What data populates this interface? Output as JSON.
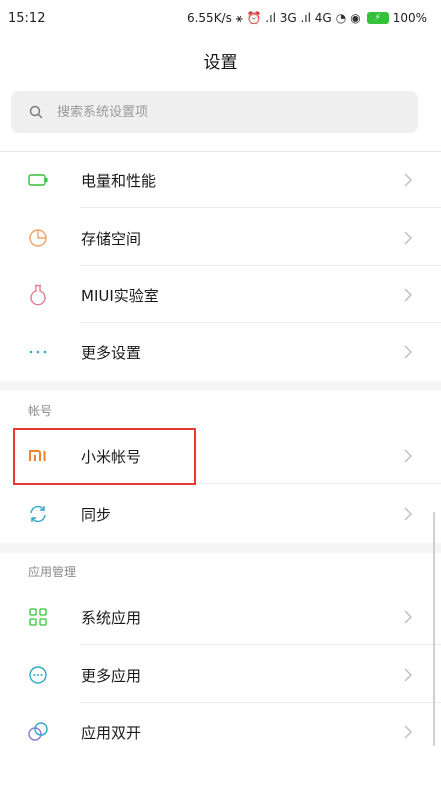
{
  "status_bar": {
    "time": "15:12",
    "indicators": "6.55K/s ⚹ ⏰ .ıl 3G .ıl 4G",
    "battery_pct": "100%"
  },
  "header": {
    "title": "设置"
  },
  "search": {
    "placeholder": "搜索系统设置项"
  },
  "sections": [
    {
      "items": [
        {
          "label": "电量和性能",
          "icon": "battery-icon"
        },
        {
          "label": "存储空间",
          "icon": "storage-pie-icon"
        },
        {
          "label": "MIUI实验室",
          "icon": "lab-flask-icon"
        },
        {
          "label": "更多设置",
          "icon": "more-dots-icon"
        }
      ]
    },
    {
      "header": "帐号",
      "items": [
        {
          "label": "小米帐号",
          "icon": "mi-logo-icon"
        },
        {
          "label": "同步",
          "icon": "sync-icon"
        }
      ]
    },
    {
      "header": "应用管理",
      "items": [
        {
          "label": "系统应用",
          "icon": "grid-apps-icon"
        },
        {
          "label": "更多应用",
          "icon": "more-apps-icon"
        },
        {
          "label": "应用双开",
          "icon": "dual-apps-icon"
        }
      ]
    }
  ],
  "colors": {
    "battery_green": "#33c23a",
    "accent_cyan": "#2fa8c9",
    "storage_orange": "#f0a36b",
    "flask_pink": "#e07d8f",
    "mi_orange": "#f5822a",
    "highlight_red": "#e53935",
    "dual_purple": "#8c7ad6"
  }
}
